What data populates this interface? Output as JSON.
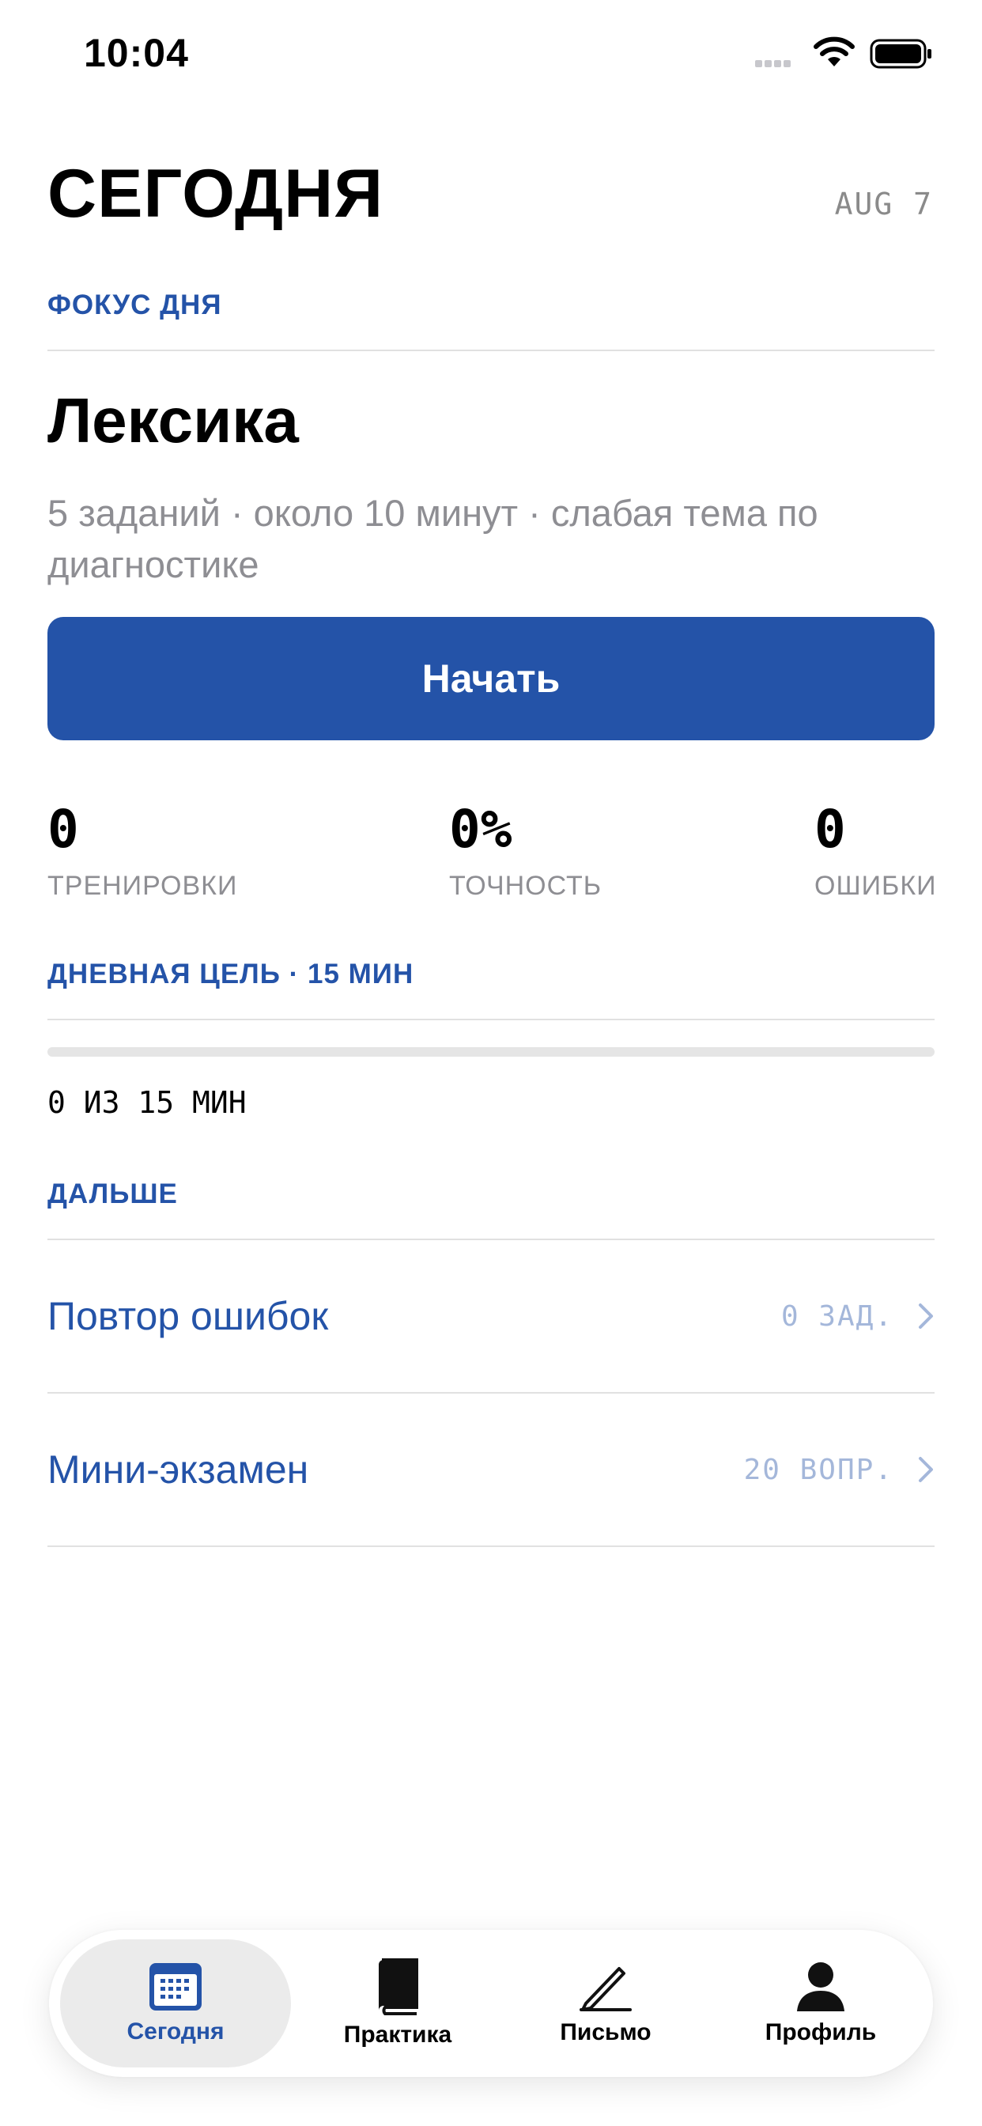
{
  "status_bar": {
    "time": "10:04"
  },
  "header": {
    "title": "СЕГОДНЯ",
    "date": "AUG 7"
  },
  "focus": {
    "section_label": "ФОКУС ДНЯ",
    "title": "Лексика",
    "description": "5 заданий · около 10 минут · слабая тема по диагностике",
    "start_label": "Начать"
  },
  "stats": [
    {
      "value": "0",
      "label": "ТРЕНИРОВКИ"
    },
    {
      "value": "0%",
      "label": "ТОЧНОСТЬ"
    },
    {
      "value": "0",
      "label": "ОШИБКИ"
    }
  ],
  "daily_goal": {
    "section_label": "ДНЕВНАЯ ЦЕЛЬ · 15 МИН",
    "progress_text": "0 ИЗ 15 МИН",
    "progress_fraction": 0
  },
  "next": {
    "section_label": "ДАЛЬШЕ",
    "items": [
      {
        "label": "Повтор ошибок",
        "count": "0 ЗАД.",
        "icon": "chevron-right-icon"
      },
      {
        "label": "Мини-экзамен",
        "count": "20 ВОПР.",
        "icon": "chevron-right-icon"
      }
    ]
  },
  "tab_bar": {
    "active": "today",
    "tabs": [
      {
        "label": "Сегодня",
        "icon": "calendar-icon"
      },
      {
        "label": "Практика",
        "icon": "book-icon"
      },
      {
        "label": "Письмо",
        "icon": "pencil-icon"
      },
      {
        "label": "Профиль",
        "icon": "person-icon"
      }
    ]
  },
  "colors": {
    "accent": "#2453a8",
    "muted": "#8e8e93",
    "count": "#a4b7da"
  }
}
